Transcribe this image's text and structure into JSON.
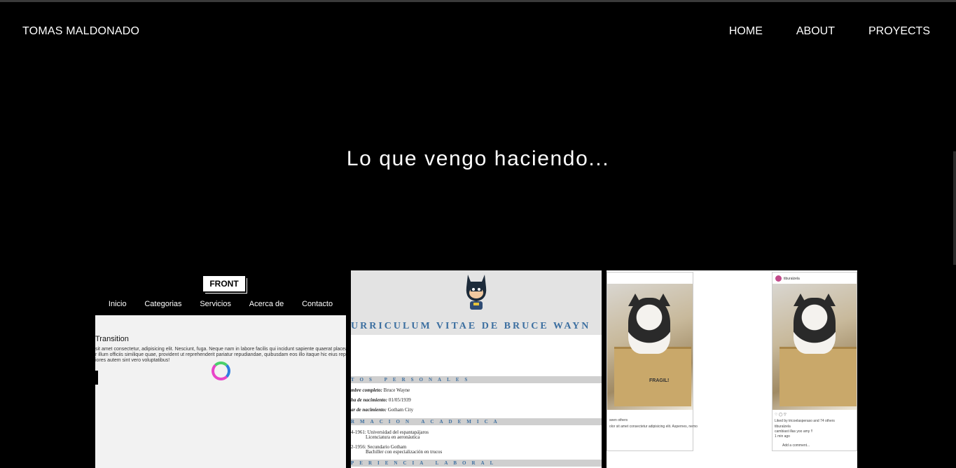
{
  "nav": {
    "brand": "TOMAS MALDONADO",
    "links": [
      "HOME",
      "ABOUT",
      "PROYECTS"
    ]
  },
  "section": {
    "title": "Lo que vengo haciendo..."
  },
  "projects": [
    {
      "logo": "FRONT",
      "menu": [
        "Inicio",
        "Categorias",
        "Servicios",
        "Acerca de",
        "Contacto"
      ],
      "heading": "Transition",
      "text": [
        "sit amet consectetur, adipisicing elit. Nesciunt, fuga. Neque nam in labore facilis qui incidunt sapiente quaerat placeat o",
        "r illum officiis similique quae, provident ut reprehenderit pariatur repudiandae, quibusdam eos illo itaque hic eius repeti",
        "iores autem sint vero voluptatibus!"
      ]
    },
    {
      "title": "URRICULUM VITAE DE BRUCE WAYN",
      "band_personal": "TOS PERSONALES",
      "personal": [
        {
          "label": "mbre completo:",
          "value": "Bruce Wayne"
        },
        {
          "label": "ha de nacimiento:",
          "value": "01/05/1939"
        },
        {
          "label": "ar de nacimiento:",
          "value": "Gotham City"
        }
      ],
      "band_academic": "RMACION ACADEMICA",
      "academic": [
        "4-1961: Universidad del espantapájaros",
        "Licenciatura en aeronáutica",
        "2-1956: Secundario Gotham",
        "Bachiller con especialización en trucos"
      ],
      "band_work": "PERIENCIA LABORAL"
    },
    {
      "user": "tiburalzela",
      "fragil": "FRAGIL!",
      "seen": "seen others",
      "caption": "olor sit amet consectetur adipisicing elit. Aspernes, nemo",
      "liked": "Liked by tricoelasperaso and 74 others",
      "comment_user": "tiburalzela",
      "comment": "cambiast illas yoo amy !!",
      "ago": "1 min ago",
      "add_comment": "Add a comment..."
    }
  ]
}
